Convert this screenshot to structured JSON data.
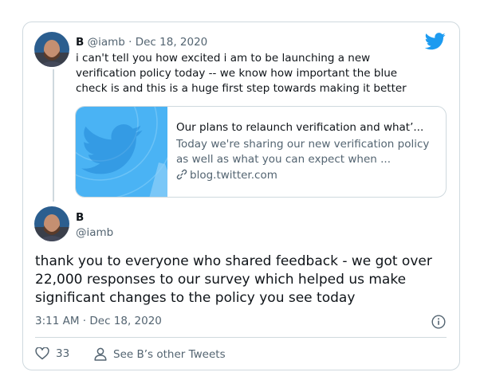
{
  "quoted_tweet": {
    "name": "B",
    "handle": "@iamb",
    "separator": "·",
    "date": "Dec 18, 2020",
    "text": "i can't tell you how excited i am to be launching a new verification policy today -- we know how important the blue check is and this is a huge first step towards making it better"
  },
  "link_card": {
    "title": "Our plans to relaunch verification and what’...",
    "description": "Today we're sharing our new verification policy as well as what you can expect when ...",
    "domain": "blog.twitter.com"
  },
  "main_tweet": {
    "name": "B",
    "handle": "@iamb",
    "text": "thank you to everyone who shared feedback - we got over 22,000 responses to our survey which helped us make significant changes to the policy you see today",
    "timestamp": "3:11 AM · Dec 18, 2020"
  },
  "actions": {
    "like_count": "33",
    "other_tweets_label": "See B’s other Tweets"
  },
  "icons": {
    "brand": "twitter-bird-icon",
    "like": "heart-icon",
    "profile": "person-icon",
    "link": "link-icon",
    "info": "info-icon"
  },
  "colors": {
    "twitter_blue": "#1d9bf0",
    "text_primary": "#0f1419",
    "text_secondary": "#536471",
    "border": "#cfd9de"
  }
}
